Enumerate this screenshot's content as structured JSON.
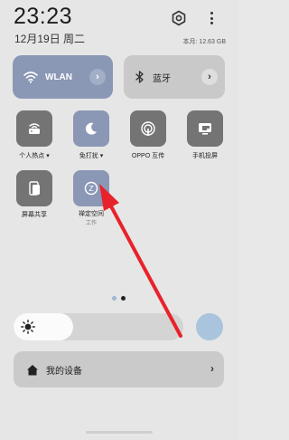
{
  "header": {
    "time": "23:23",
    "date": "12月19日 周二",
    "storage": "本月: 12.63 GB",
    "settings_icon": "gear-icon",
    "more_icon": "more-vertical-icon"
  },
  "big_tiles": {
    "wlan": {
      "label": "WLAN",
      "icon": "wifi-icon",
      "active": true
    },
    "bluetooth": {
      "label": "蓝牙",
      "icon": "bluetooth-icon",
      "active": false
    }
  },
  "tiles": [
    {
      "id": "hotspot",
      "label": "个人热点",
      "dropdown": true,
      "icon": "hotspot-icon",
      "active": false
    },
    {
      "id": "dnd",
      "label": "免打扰",
      "dropdown": true,
      "icon": "moon-icon",
      "active": true
    },
    {
      "id": "oppo-share",
      "label": "OPPO 互传",
      "icon": "share-icon",
      "active": false
    },
    {
      "id": "cast",
      "label": "手机投屏",
      "icon": "cast-icon",
      "active": false
    },
    {
      "id": "screen-share",
      "label": "屏幕共享",
      "icon": "screen-share-icon",
      "active": false
    },
    {
      "id": "focus-space",
      "label": "禅定空间",
      "sub": "工作",
      "icon": "focus-icon",
      "active": true
    }
  ],
  "pagination": {
    "pages": 2,
    "current": 2
  },
  "brightness": {
    "level": 0.35,
    "icon": "sun-icon"
  },
  "devices": {
    "label": "我的设备",
    "icon": "home-icon"
  },
  "colors": {
    "accent": "#8a97b5",
    "annotation": "#e8222b"
  }
}
